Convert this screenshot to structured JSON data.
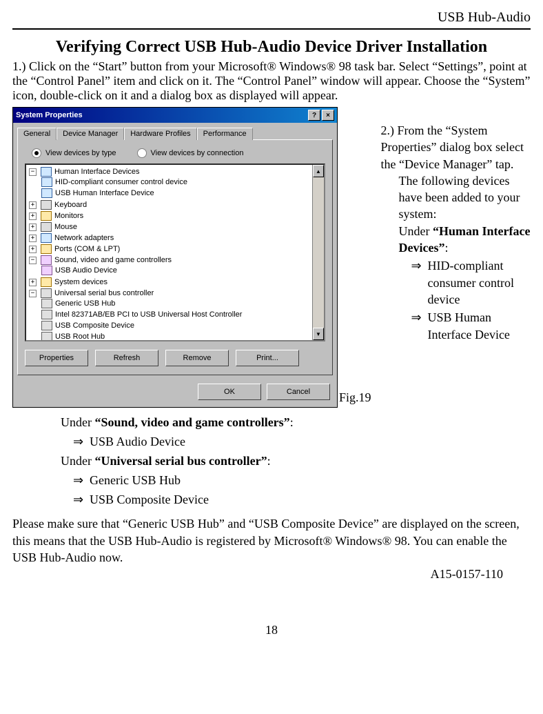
{
  "header": {
    "product": "USB Hub-Audio"
  },
  "title": "Verifying Correct USB Hub-Audio Device Driver Installation",
  "step1": {
    "num": "1.)",
    "text": "Click on the “Start” button from your Microsoft® Windows® 98 task bar. Select “Settings”, point at the “Control Panel” item and click on it. The “Control Panel” window will appear. Choose the “System” icon, double-click on it and a dialog box as displayed will appear."
  },
  "screenshot": {
    "title": "System Properties",
    "help_btn": "?",
    "close_btn": "×",
    "tabs": [
      "General",
      "Device Manager",
      "Hardware Profiles",
      "Performance"
    ],
    "active_tab_index": 1,
    "radio_type": "View devices by type",
    "radio_conn": "View devices by connection",
    "tree": {
      "hid": {
        "label": "Human Interface Devices",
        "children": [
          "HID-compliant consumer control device",
          "USB Human Interface Device"
        ]
      },
      "keyboard": "Keyboard",
      "monitors": "Monitors",
      "mouse": "Mouse",
      "net": "Network adapters",
      "ports": "Ports (COM & LPT)",
      "sound": {
        "label": "Sound, video and game controllers",
        "children": [
          "USB Audio Device"
        ]
      },
      "sysdev": "System devices",
      "usb": {
        "label": "Universal serial bus controller",
        "children": [
          "Generic USB Hub",
          "Intel 82371AB/EB PCI to USB Universal Host Controller",
          "USB Composite Device",
          "USB Root Hub"
        ]
      }
    },
    "buttons": {
      "properties": "Properties",
      "refresh": "Refresh",
      "remove": "Remove",
      "print": "Print..."
    },
    "dlg_buttons": {
      "ok": "OK",
      "cancel": "Cancel"
    },
    "scroll_up": "▲",
    "scroll_down": "▼"
  },
  "fig_label": "Fig.19",
  "step2": {
    "num": "2.)",
    "intro": "From the “System Properties” dialog box select the “Device Manager” tap.",
    "line2": "The following devices have been added to your system:",
    "under_pre": "Under ",
    "hid_title": "“Human Interface Devices”",
    "hid_colon": ":",
    "hid_items": [
      "HID-compliant consumer control device",
      "USB Human Interface Device"
    ]
  },
  "under2": {
    "pre": "Under ",
    "sound_title": "“Sound, video and game controllers”",
    "sound_colon": ":",
    "sound_items": [
      "USB Audio Device"
    ],
    "usb_title": "“Universal serial bus controller”",
    "usb_colon": ":",
    "usb_items": [
      "Generic USB Hub",
      "USB Composite Device"
    ]
  },
  "closing": "Please make sure that “Generic USB Hub” and “USB Composite Device” are displayed on the screen, this means that the USB Hub-Audio is registered by Microsoft® Windows® 98. You can enable the USB Hub-Audio now.",
  "docnum": "A15-0157-110",
  "pagenum": "18",
  "exp_minus": "−",
  "exp_plus": "+"
}
